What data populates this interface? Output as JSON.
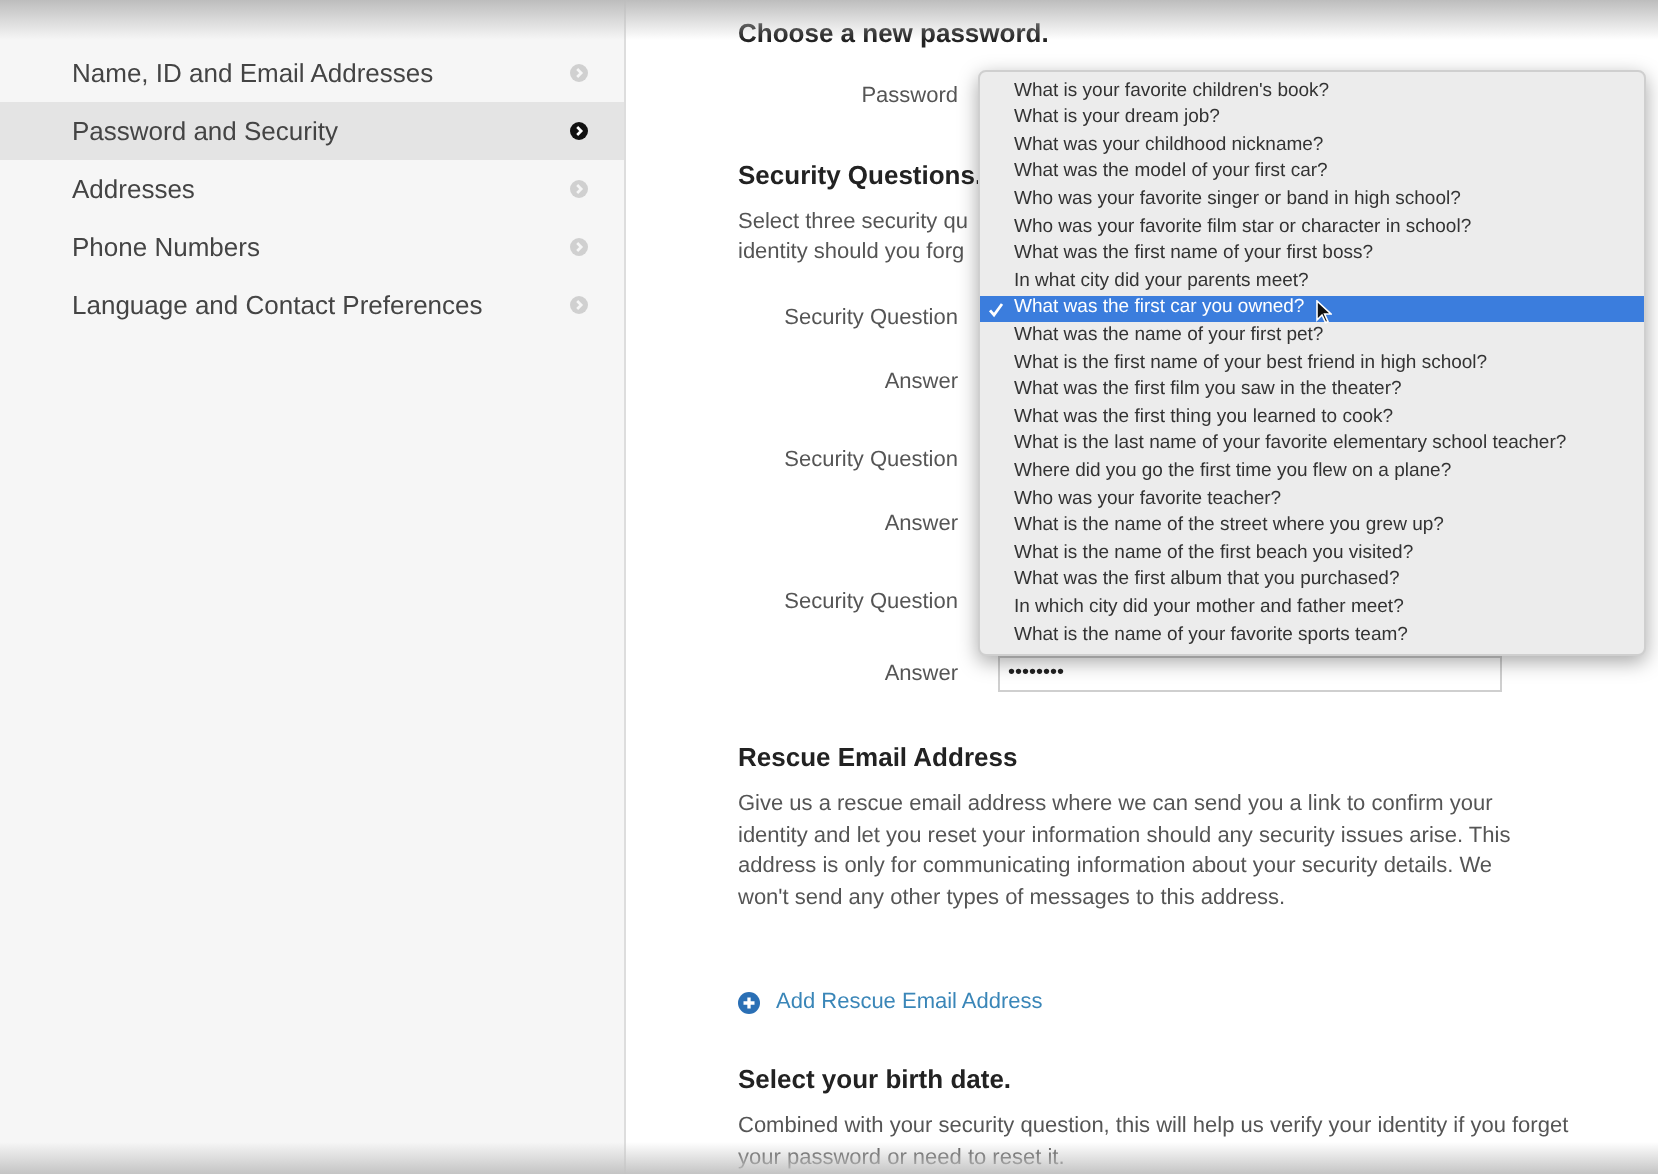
{
  "sidebar": {
    "items": [
      {
        "label": "Name, ID and Email Addresses",
        "selected": false
      },
      {
        "label": "Password and Security",
        "selected": true
      },
      {
        "label": "Addresses",
        "selected": false
      },
      {
        "label": "Phone Numbers",
        "selected": false
      },
      {
        "label": "Language and Contact Preferences",
        "selected": false
      }
    ]
  },
  "password_section": {
    "heading": "Choose a new password.",
    "password_label": "Password"
  },
  "security_questions": {
    "heading": "Security Questions.",
    "description_lines": [
      "Select three security qu",
      "identity should you forg"
    ],
    "rows": [
      {
        "kind": "question",
        "label": "Security Question"
      },
      {
        "kind": "answer",
        "label": "Answer"
      },
      {
        "kind": "question",
        "label": "Security Question"
      },
      {
        "kind": "answer",
        "label": "Answer"
      },
      {
        "kind": "question",
        "label": "Security Question"
      },
      {
        "kind": "answer",
        "label": "Answer",
        "value": "••••••••"
      }
    ]
  },
  "dropdown": {
    "options": [
      {
        "text": "What is your favorite children's book?",
        "selected": false
      },
      {
        "text": "What is your dream job?",
        "selected": false
      },
      {
        "text": "What was your childhood nickname?",
        "selected": false
      },
      {
        "text": "What was the model of your first car?",
        "selected": false
      },
      {
        "text": "Who was your favorite singer or band in high school?",
        "selected": false
      },
      {
        "text": "Who was your favorite film star or character in school?",
        "selected": false
      },
      {
        "text": "What was the first name of your first boss?",
        "selected": false
      },
      {
        "text": "In what city did your parents meet?",
        "selected": false
      },
      {
        "text": "What was the first car you owned?",
        "selected": true
      },
      {
        "text": "What was the name of your first pet?",
        "selected": false
      },
      {
        "text": "What is the first name of your best friend in high school?",
        "selected": false
      },
      {
        "text": "What was the first film you saw in the theater?",
        "selected": false
      },
      {
        "text": "What was the first thing you learned to cook?",
        "selected": false
      },
      {
        "text": "What is the last name of your favorite elementary school teacher?",
        "selected": false
      },
      {
        "text": "Where did you go the first time you flew on a plane?",
        "selected": false
      },
      {
        "text": "Who was your favorite teacher?",
        "selected": false
      },
      {
        "text": "What is the name of the street where you grew up?",
        "selected": false
      },
      {
        "text": "What is the name of the first beach you visited?",
        "selected": false
      },
      {
        "text": "What was the first album that you purchased?",
        "selected": false
      },
      {
        "text": "In which city did your mother and father meet?",
        "selected": false
      },
      {
        "text": "What is the name of your favorite sports team?",
        "selected": false
      }
    ]
  },
  "rescue_email": {
    "heading": "Rescue Email Address",
    "description": "Give us a rescue email address where we can send you a link to confirm your identity and let you reset your information should any security issues arise. This address is only for communicating information about your security details. We won't send any other types of messages to this address.",
    "add_link": "Add Rescue Email Address"
  },
  "birth_date": {
    "heading": "Select your birth date.",
    "description": "Combined with your security question, this will help us verify your identity if you forget your password or need to reset it."
  }
}
